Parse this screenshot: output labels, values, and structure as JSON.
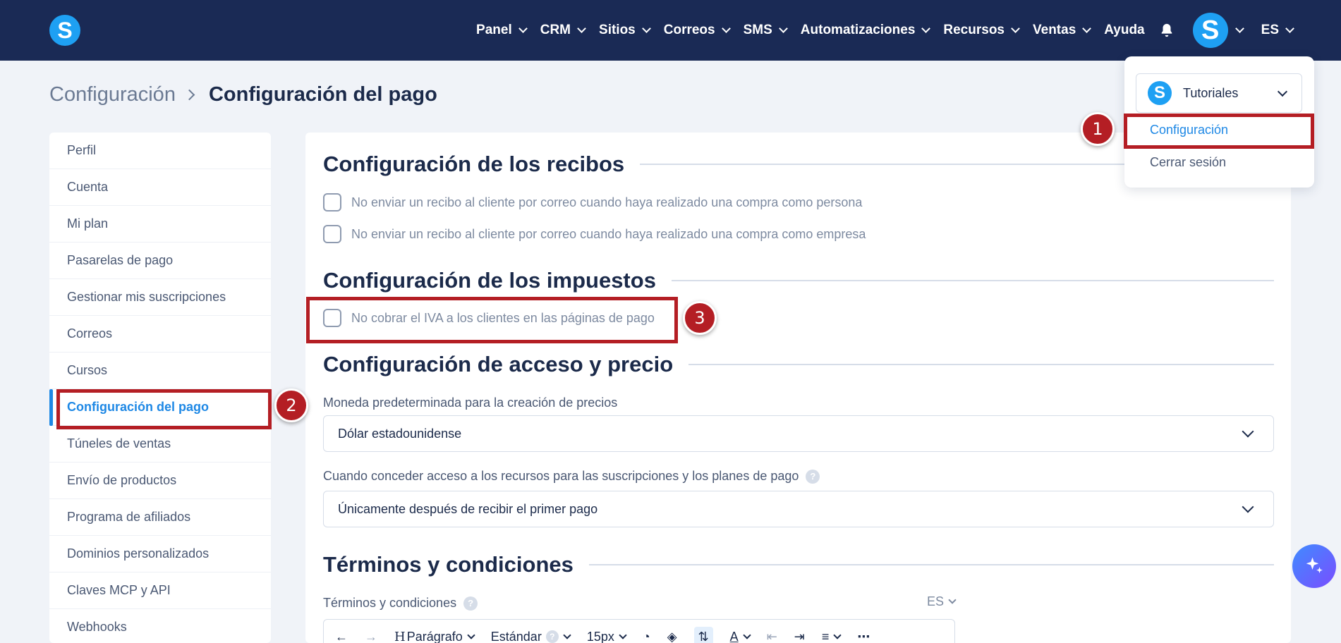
{
  "header": {
    "logo_letter": "S",
    "nav": [
      {
        "label": "Panel"
      },
      {
        "label": "CRM"
      },
      {
        "label": "Sitios"
      },
      {
        "label": "Correos"
      },
      {
        "label": "SMS"
      },
      {
        "label": "Automatizaciones"
      },
      {
        "label": "Recursos"
      },
      {
        "label": "Ventas"
      },
      {
        "label": "Ayuda"
      }
    ],
    "avatar_letter": "S",
    "language": "ES"
  },
  "breadcrumb": {
    "parent": "Configuración",
    "current": "Configuración del pago"
  },
  "sidebar": {
    "items": [
      {
        "label": "Perfil"
      },
      {
        "label": "Cuenta"
      },
      {
        "label": "Mi plan"
      },
      {
        "label": "Pasarelas de pago"
      },
      {
        "label": "Gestionar mis suscripciones"
      },
      {
        "label": "Correos"
      },
      {
        "label": "Cursos"
      },
      {
        "label": "Configuración del pago"
      },
      {
        "label": "Túneles de ventas"
      },
      {
        "label": "Envío de productos"
      },
      {
        "label": "Programa de afiliados"
      },
      {
        "label": "Dominios personalizados"
      },
      {
        "label": "Claves MCP y API"
      },
      {
        "label": "Webhooks"
      }
    ],
    "active_index": 7
  },
  "main": {
    "receipts": {
      "title": "Configuración de los recibos",
      "options": [
        "No enviar un recibo al cliente por correo cuando haya realizado una compra como persona",
        "No enviar un recibo al cliente por correo cuando haya realizado una compra como empresa"
      ]
    },
    "taxes": {
      "title": "Configuración de los impuestos",
      "option": "No cobrar el IVA a los clientes en las páginas de pago"
    },
    "access": {
      "title": "Configuración de acceso y precio",
      "currency_label": "Moneda predeterminada para la creación de precios",
      "currency_value": "Dólar estadounidense",
      "access_label": "Cuando conceder acceso a los recursos para las suscripciones y los planes de pago",
      "access_value": "Únicamente después de recibir el primer pago"
    },
    "terms": {
      "title": "Términos y condiciones",
      "field_label": "Términos y condiciones",
      "language": "ES",
      "toolbar": {
        "paragraph": "Parágrafo",
        "style": "Estándar",
        "font_size": "15px"
      }
    }
  },
  "account_menu": {
    "account_name": "Tutoriales",
    "logo_letter": "S",
    "items": [
      "Configuración",
      "Cerrar sesión"
    ]
  },
  "annotations": {
    "markers": [
      "1",
      "2",
      "3"
    ],
    "color": "#b41e24"
  },
  "help_glyph": "?",
  "colors": {
    "header_bg": "#1a2a55",
    "accent": "#1e88e5",
    "logo": "#1ea0f3"
  }
}
